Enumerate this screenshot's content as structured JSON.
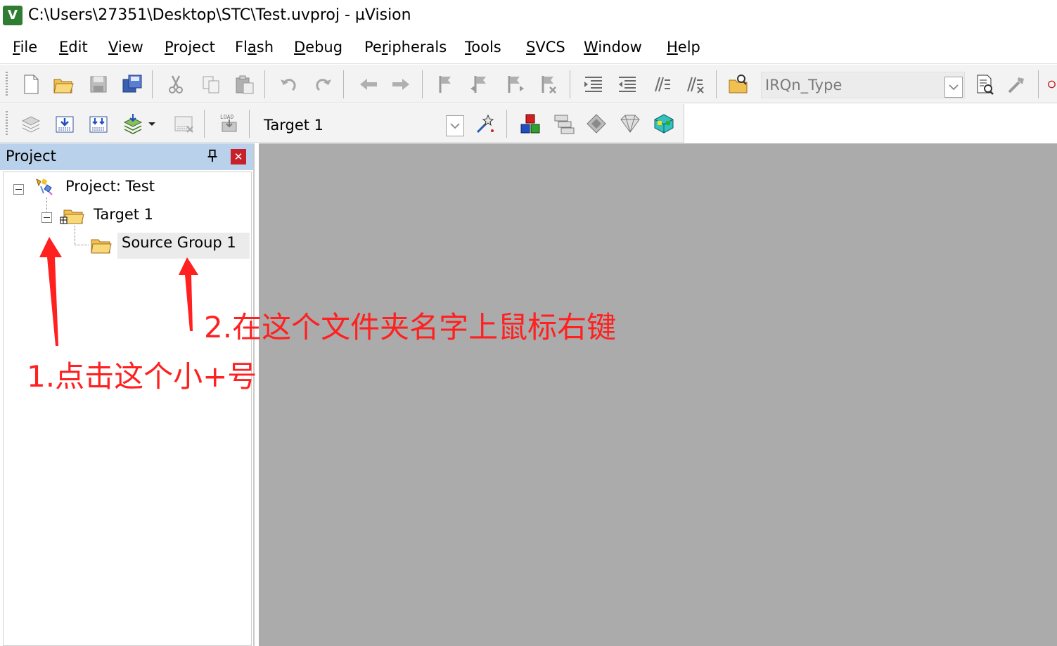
{
  "window": {
    "title": "C:\\Users\\27351\\Desktop\\STC\\Test.uvproj - µVision",
    "icon": "uvision-app-icon"
  },
  "menu": [
    {
      "key": "F",
      "rest": "ile"
    },
    {
      "key": "E",
      "rest": "dit"
    },
    {
      "key": "V",
      "rest": "iew"
    },
    {
      "key": "P",
      "rest": "roject"
    },
    {
      "pre": "Fl",
      "key": "a",
      "rest": "sh"
    },
    {
      "key": "D",
      "rest": "ebug"
    },
    {
      "pre": "Pe",
      "key": "r",
      "rest": "ipherals"
    },
    {
      "key": "T",
      "rest": "ools"
    },
    {
      "key": "S",
      "rest": "VCS"
    },
    {
      "key": "W",
      "rest": "indow"
    },
    {
      "key": "H",
      "rest": "elp"
    }
  ],
  "toolbar1": {
    "find_combo_value": "IRQn_Type"
  },
  "toolbar2": {
    "target_combo_value": "Target 1"
  },
  "project_panel": {
    "title": "Project",
    "pin_icon": "pin-icon",
    "close_icon": "close-icon",
    "tree": {
      "root": "Project: Test",
      "target": "Target 1",
      "group": "Source Group 1"
    }
  },
  "annotations": {
    "note1": "1.点击这个小+号",
    "note2": "2.在这个文件夹名字上鼠标右键",
    "arrow_color": "#ff2020"
  },
  "colors": {
    "panel_header": "#b9d1ea",
    "workspace_gray": "#ababab",
    "annotation_red": "#ff2020"
  }
}
